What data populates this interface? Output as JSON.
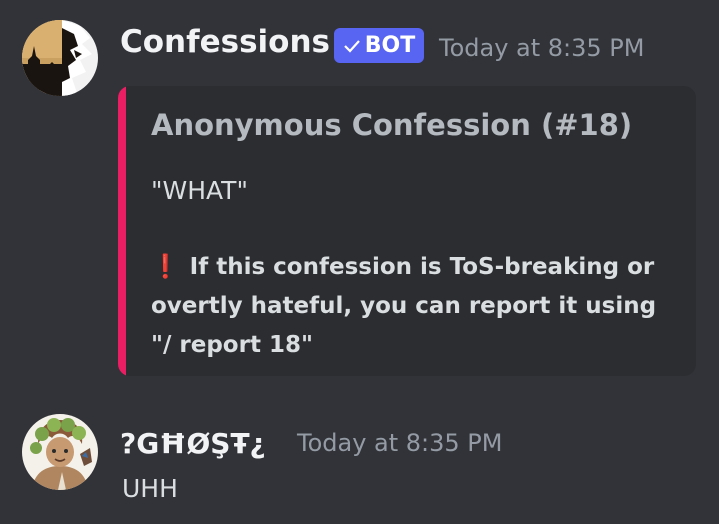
{
  "messages": [
    {
      "avatar_icon": "fox-silhouette-avatar",
      "username": "Confessions",
      "bot_tag": "BOT",
      "bot_check_icon": "checkmark-icon",
      "timestamp": "Today at 8:35 PM",
      "embed": {
        "accent_color": "#e91e63",
        "title": "Anonymous Confession (#18)",
        "description": "\"WHAT\"",
        "footer_icon": "❗",
        "footer_text": "If this confession is ToS-breaking or overtly hateful, you can report it using \"/ report 18\""
      }
    },
    {
      "avatar_icon": "cartoon-character-avatar",
      "username": "?GĦØŞŦ¿",
      "timestamp": "Today at 8:35 PM",
      "text": "UHH"
    }
  ],
  "colors": {
    "background": "#313338",
    "embed_background": "#2b2d31",
    "bot_tag": "#5865f2",
    "username": "#f2f3f5",
    "timestamp": "#949ba4"
  }
}
